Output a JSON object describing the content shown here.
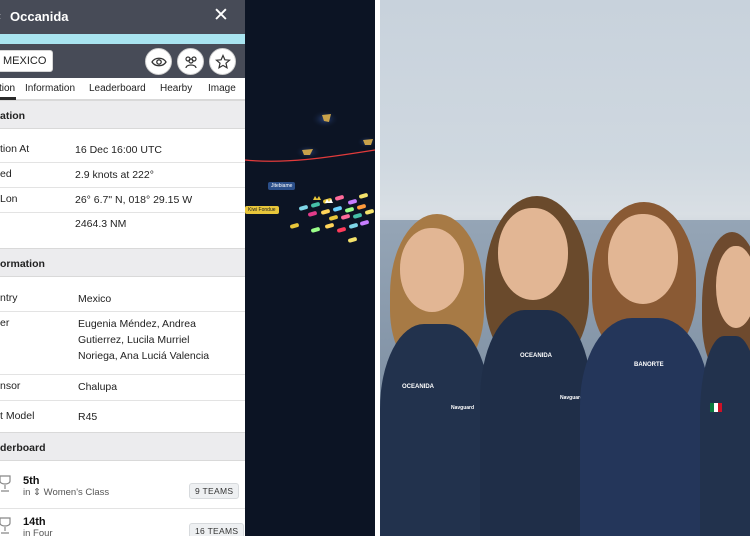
{
  "header": {
    "back_glyph": "‹",
    "title": "Occanida",
    "close_glyph": "✕"
  },
  "toolbar": {
    "country": "MEXICO",
    "buttons": [
      {
        "name": "eye-icon"
      },
      {
        "name": "crew-icon"
      },
      {
        "name": "star-icon"
      }
    ]
  },
  "tabs": [
    "tion",
    "Information",
    "Leaderboard",
    "Hearby",
    "Image"
  ],
  "position_section": {
    "title": "ation",
    "rows": [
      {
        "label": "tion At",
        "value": "16 Dec 16:00 UTC"
      },
      {
        "label": "ed",
        "value": "2.9 knots at 222°"
      },
      {
        "label": "Lon",
        "value": "26° 6.7\" N, 018° 29.15 W"
      },
      {
        "label": "",
        "value": "2464.3 NM"
      }
    ]
  },
  "info_section": {
    "title": "ormation",
    "country_label": "ntry",
    "country_value": "Mexico",
    "crew_label": "er",
    "crew_lines": [
      "Eugenia Méndez, Andrea",
      "Gutierrez, Lucila Murriel",
      "Noriega, Ana Luciá Valencia"
    ],
    "sponsor_label": "nsor",
    "sponsor_value": "Chalupa",
    "model_label": "t Model",
    "model_value": "R45"
  },
  "leaderboard_section": {
    "title": "derboard",
    "entries": [
      {
        "rank": "5th",
        "class_prefix": "in",
        "class_name": "Women's Class",
        "teams": "9 TEAMS"
      },
      {
        "rank": "14th",
        "class_prefix": "in",
        "class_name": "Four",
        "teams": "16 TEAMS"
      }
    ]
  },
  "map": {
    "labels": [
      {
        "text": "Jitebiame",
        "color": "#2b4f8a"
      },
      {
        "text": "Kiwi Fondue",
        "color": "#e8c63a"
      }
    ],
    "track_color": "#e23b3b"
  },
  "photo": {
    "shirt_logos": [
      "OCEANIDA",
      "OCEANIDA",
      "BANORTE",
      "Navguard",
      "Navguard"
    ],
    "shirt_color": "#22324d"
  },
  "colors": {
    "header": "#474b57",
    "accent": "#a9e4f0"
  }
}
